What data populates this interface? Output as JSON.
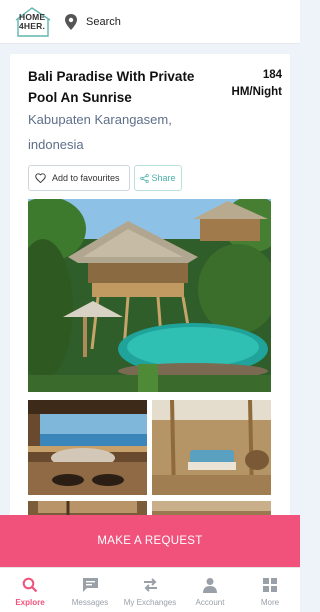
{
  "header": {
    "logo_text_line1": "HOME",
    "logo_text_line2": "4HER.",
    "search_label": "Search"
  },
  "listing": {
    "title": "Bali Paradise With Private Pool An Sunrise",
    "price": "184",
    "price_unit": "HM/Night",
    "location": "Kabupaten Karangasem, indonesia",
    "favourite_label": "Add to favourites",
    "share_label": "Share"
  },
  "cta": {
    "request_label": "MAKE A REQUEST"
  },
  "bottom_nav": {
    "items": [
      {
        "label": "Explore",
        "icon": "search-icon",
        "active": true
      },
      {
        "label": "Messages",
        "icon": "message-icon",
        "active": false
      },
      {
        "label": "My Exchanges",
        "icon": "exchange-icon",
        "active": false
      },
      {
        "label": "Account",
        "icon": "account-icon",
        "active": false
      },
      {
        "label": "More",
        "icon": "grid-icon",
        "active": false
      }
    ]
  },
  "colors": {
    "accent": "#f0527b",
    "share": "#4db0aa",
    "location_text": "#5e6f8a"
  }
}
